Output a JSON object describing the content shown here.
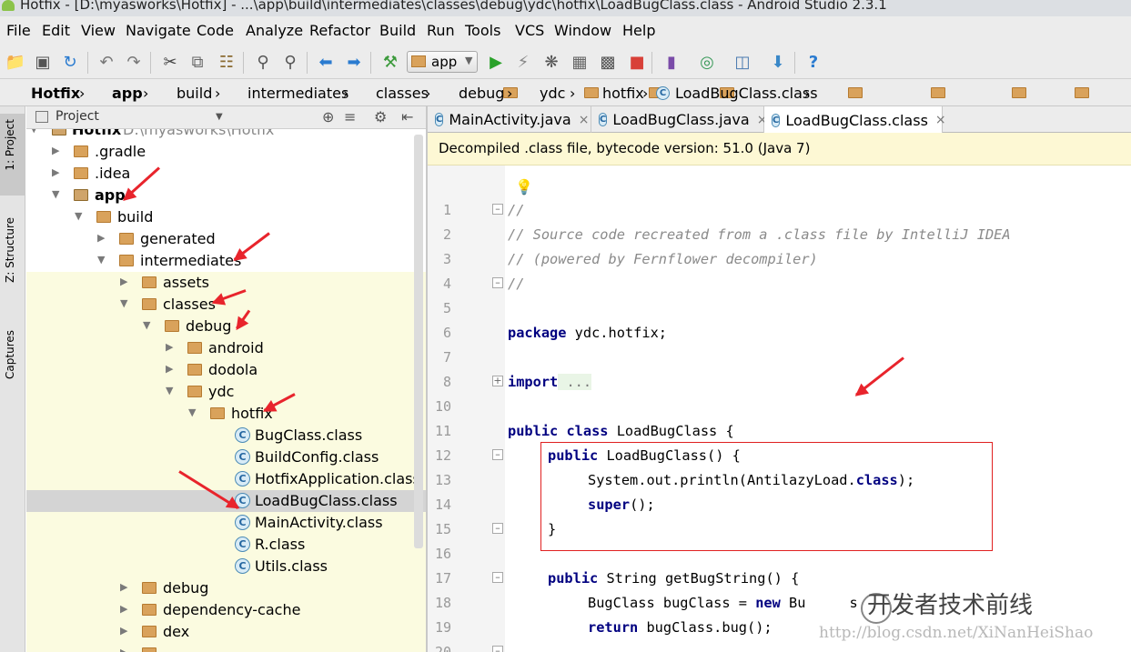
{
  "window": {
    "title": "Hotfix - [D:\\myasworks\\Hotfix] - ...\\app\\build\\intermediates\\classes\\debug\\ydc\\hotfix\\LoadBugClass.class - Android Studio 2.3.1"
  },
  "menu": [
    "File",
    "Edit",
    "View",
    "Navigate",
    "Code",
    "Analyze",
    "Refactor",
    "Build",
    "Run",
    "Tools",
    "VCS",
    "Window",
    "Help"
  ],
  "toolbar": {
    "run_config": "app",
    "icons": [
      "open-folder-icon",
      "save-icon",
      "sync-icon",
      "undo-icon",
      "redo-icon",
      "cut-icon",
      "copy-icon",
      "paste-icon",
      "find-icon",
      "replace-icon",
      "back-icon",
      "forward-icon",
      "make-project-icon",
      "run-icon",
      "apply-changes-icon",
      "debug-icon",
      "profile-icon",
      "attach-debugger-icon",
      "stop-icon",
      "avd-manager-icon",
      "sdk-manager-icon",
      "project-structure-icon",
      "android-monitor-icon",
      "help-icon"
    ]
  },
  "breadcrumbs": [
    "Hotfix",
    "app",
    "build",
    "intermediates",
    "classes",
    "debug",
    "ydc",
    "hotfix",
    "LoadBugClass.class"
  ],
  "left_tool_tabs": [
    "1: Project",
    "Z: Structure",
    "Captures"
  ],
  "project_panel": {
    "view_selector": "Project",
    "root_label": "Hotfix",
    "root_path": "D:\\myasworks\\Hotfix",
    "tree": [
      {
        "label": ".gradle"
      },
      {
        "label": ".idea"
      },
      {
        "label": "app"
      },
      {
        "label": "build"
      },
      {
        "label": "generated"
      },
      {
        "label": "intermediates"
      },
      {
        "label": "assets"
      },
      {
        "label": "classes"
      },
      {
        "label": "debug"
      },
      {
        "label": "android"
      },
      {
        "label": "dodola"
      },
      {
        "label": "ydc"
      },
      {
        "label": "hotfix"
      },
      {
        "label": "BugClass.class"
      },
      {
        "label": "BuildConfig.class"
      },
      {
        "label": "HotfixApplication.class"
      },
      {
        "label": "LoadBugClass.class"
      },
      {
        "label": "MainActivity.class"
      },
      {
        "label": "R.class"
      },
      {
        "label": "Utils.class"
      },
      {
        "label": "debug"
      },
      {
        "label": "dependency-cache"
      },
      {
        "label": "dex"
      }
    ]
  },
  "editor_tabs": [
    {
      "label": "MainActivity.java",
      "close": "×"
    },
    {
      "label": "LoadBugClass.java",
      "close": "×"
    },
    {
      "label": "LoadBugClass.class",
      "close": "×"
    }
  ],
  "banner": "Decompiled .class file, bytecode version: 51.0 (Java 7)",
  "code": {
    "line_numbers": [
      "1",
      "2",
      "3",
      "4",
      "5",
      "6",
      "7",
      "8",
      "10",
      "11",
      "12",
      "13",
      "14",
      "15",
      "16",
      "17",
      "18",
      "19",
      "20"
    ],
    "lines": {
      "l1": "//",
      "l2": "// Source code recreated from a .class file by IntelliJ IDEA",
      "l3": "// (powered by Fernflower decompiler)",
      "l4": "//",
      "l6_kw": "package",
      "l6_rest": " ydc.hotfix;",
      "l8_kw": "import",
      "l8_rest": " ...",
      "l11_kw1": "public class",
      "l11_rest": " LoadBugClass {",
      "l12_kw": "public",
      "l12_rest": " LoadBugClass() {",
      "l13_pre": "System.out.println(AntilazyLoad.",
      "l13_kw": "class",
      "l13_post": ");",
      "l14_kw": "super",
      "l14_rest": "();",
      "l15": "}",
      "l17_kw": "public",
      "l17_rest": " String getBugString() {",
      "l18_pre": "BugClass bugClass = ",
      "l18_kw": "new",
      "l18_rest": " Bu",
      "l18_tail": "s",
      "l19_kw": "return",
      "l19_rest": " bugClass.bug();"
    }
  },
  "watermark": {
    "channel": "开发者技术前线",
    "url": "http://blog.csdn.net/XiNanHeiShao"
  },
  "colors": {
    "keyword": "#000080",
    "comment": "#8a8a8a",
    "annotation_red": "#e8242c",
    "banner": "#fdf8d4",
    "folder": "#d9a25b"
  }
}
